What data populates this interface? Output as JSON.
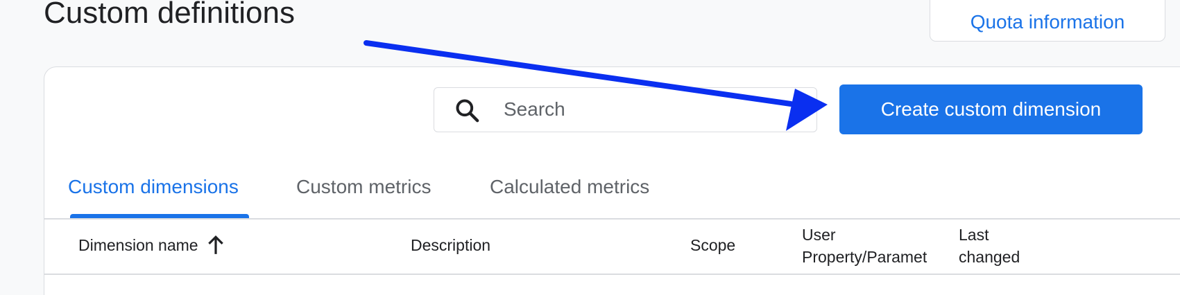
{
  "page": {
    "title": "Custom definitions",
    "quota_button_label": "Quota information"
  },
  "toolbar": {
    "search_placeholder": "Search",
    "search_value": "",
    "create_button_label": "Create custom dimension"
  },
  "tabs": [
    {
      "label": "Custom dimensions",
      "active": true
    },
    {
      "label": "Custom metrics",
      "active": false
    },
    {
      "label": "Calculated metrics",
      "active": false
    }
  ],
  "table": {
    "columns": [
      {
        "label": "Dimension name",
        "sort": "ascending"
      },
      {
        "label": "Description"
      },
      {
        "label": "Scope"
      },
      {
        "label_lines": [
          "User",
          "Property/Paramet"
        ]
      },
      {
        "label_lines": [
          "Last",
          "changed"
        ]
      }
    ]
  },
  "annotation": {
    "arrow_color": "#0a2ff0"
  },
  "colors": {
    "accent": "#1a73e8",
    "page_background": "#f8f9fa",
    "border": "#dadce0",
    "text_primary": "#202124",
    "text_secondary": "#5f6368"
  }
}
